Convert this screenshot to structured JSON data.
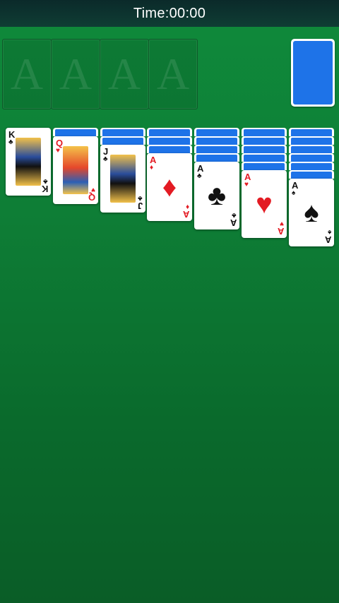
{
  "header": {
    "timer": "Time:00:00"
  },
  "foundations": [
    {
      "placeholder": "A"
    },
    {
      "placeholder": "A"
    },
    {
      "placeholder": "A"
    },
    {
      "placeholder": "A"
    }
  ],
  "stock": {
    "state": "face-down"
  },
  "tableau": [
    {
      "hidden_cards": 0,
      "top": {
        "rank": "K",
        "suit": "♣",
        "color": "black",
        "face_card": true
      }
    },
    {
      "hidden_cards": 1,
      "top": {
        "rank": "Q",
        "suit": "♥",
        "color": "red",
        "face_card": true
      }
    },
    {
      "hidden_cards": 2,
      "top": {
        "rank": "J",
        "suit": "♣",
        "color": "black",
        "face_card": true
      }
    },
    {
      "hidden_cards": 3,
      "top": {
        "rank": "A",
        "suit": "♦",
        "color": "red",
        "face_card": false
      }
    },
    {
      "hidden_cards": 4,
      "top": {
        "rank": "A",
        "suit": "♣",
        "color": "black",
        "face_card": false
      }
    },
    {
      "hidden_cards": 5,
      "top": {
        "rank": "A",
        "suit": "♥",
        "color": "red",
        "face_card": false
      }
    },
    {
      "hidden_cards": 6,
      "top": {
        "rank": "A",
        "suit": "♠",
        "color": "black",
        "face_card": false
      }
    }
  ],
  "colors": {
    "felt": "#0f8a3b",
    "card_back": "#1e73e8",
    "red_suit": "#e31b23"
  }
}
